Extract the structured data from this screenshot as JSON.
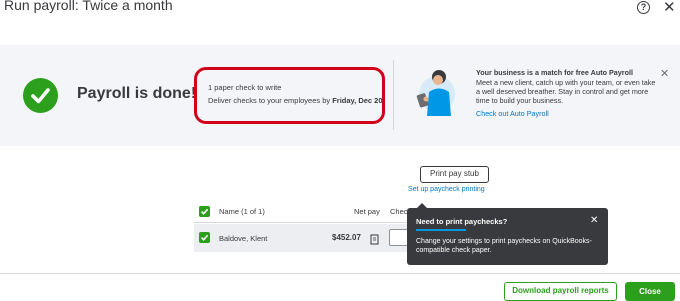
{
  "window": {
    "title": "Run payroll: Twice a month",
    "help_icon": "help-icon",
    "close_icon": "close-icon"
  },
  "banner": {
    "done_text": "Payroll is done!",
    "checks": {
      "title": "1 paper check to write",
      "desc_prefix": "Deliver checks to your employees by ",
      "desc_date": "Friday, Dec 20."
    },
    "promo": {
      "title": "Your business is a match for free Auto Payroll",
      "body": "Meet a new client, catch up with your team, or even take a well deserved breather. Stay in control and get more time to build your business.",
      "link": "Check out Auto Payroll"
    }
  },
  "actions": {
    "print_stub": "Print pay stub",
    "setup_link": "Set up paycheck printing"
  },
  "table": {
    "headers": {
      "name": "Name (1 of 1)",
      "net_pay": "Net pay",
      "check": "Chec"
    },
    "rows": [
      {
        "name": "Baldove, Klent",
        "net_pay": "$452.07"
      }
    ]
  },
  "tooltip": {
    "title": "Need to print paychecks?",
    "body": "Change your settings to print paychecks on QuickBooks-compatible check paper."
  },
  "footer": {
    "download_reports": "Download payroll reports",
    "close": "Close"
  },
  "colors": {
    "brand_green": "#2ca01c",
    "link_blue": "#0077c5",
    "highlight_red": "#d0021b",
    "tooltip_bg": "#393a3d"
  }
}
